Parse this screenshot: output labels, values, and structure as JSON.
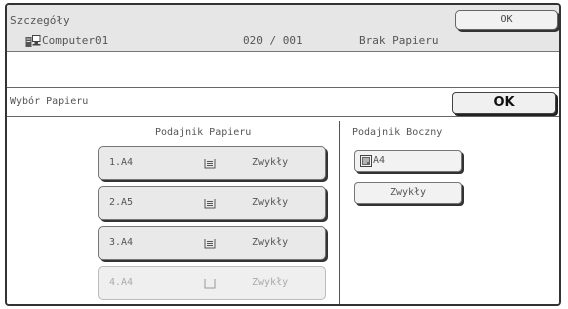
{
  "header": {
    "title": "Szczegóły",
    "ok_label": "OK"
  },
  "job": {
    "icon": "computer-icon",
    "name": "Computer01",
    "count": "020 / 001",
    "status": "Brak Papieru"
  },
  "paper_selection": {
    "title": "Wybór Papieru",
    "ok_label": "OK",
    "tray_heading": "Podajnik Papieru",
    "side_heading": "Podajnik Boczny",
    "trays": [
      {
        "label": "1.A4",
        "icon": "paper-stack-icon",
        "type": "Zwykły",
        "enabled": true
      },
      {
        "label": "2.A5",
        "icon": "paper-stack-icon",
        "type": "Zwykły",
        "enabled": true
      },
      {
        "label": "3.A4",
        "icon": "paper-stack-icon",
        "type": "Zwykły",
        "enabled": true
      },
      {
        "label": "4.A4",
        "icon": "empty-tray-icon",
        "type": "Zwykły",
        "enabled": false
      }
    ],
    "bypass": {
      "size_icon": "bypass-tray-icon",
      "size_label": "A4",
      "type_label": "Zwykły"
    }
  }
}
